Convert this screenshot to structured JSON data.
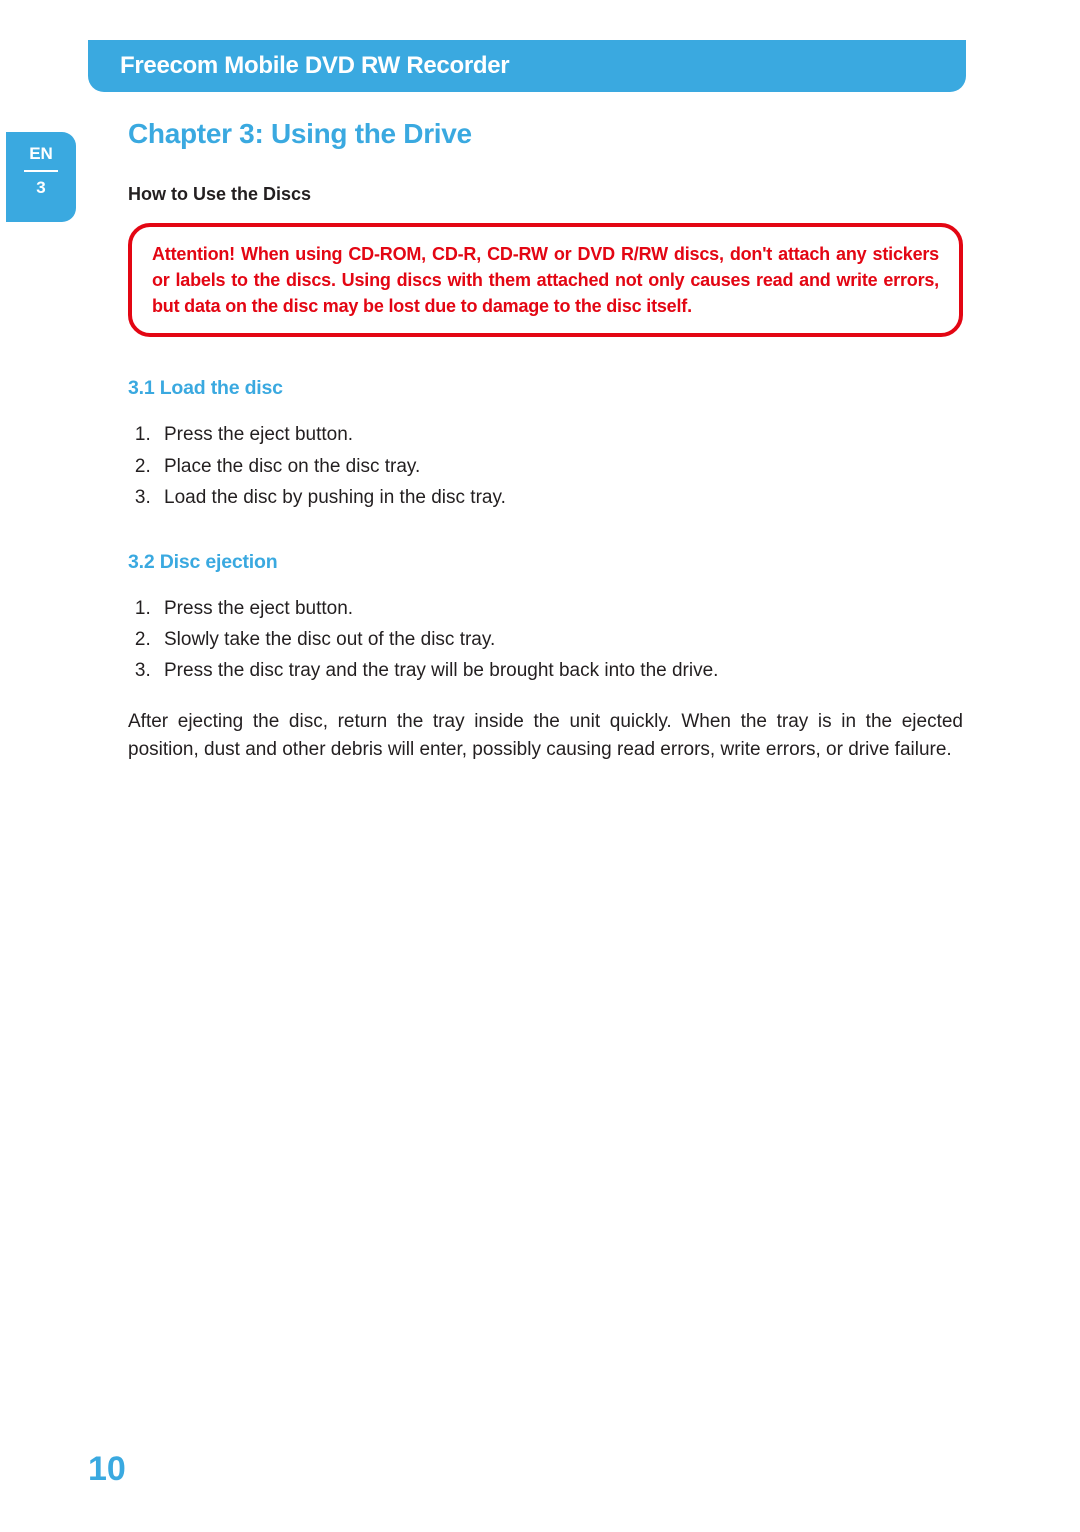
{
  "header": {
    "title": "Freecom Mobile DVD RW Recorder"
  },
  "sideTab": {
    "lang": "EN",
    "chapter": "3"
  },
  "chapter": {
    "title": "Chapter 3:  Using the Drive"
  },
  "section": {
    "title": "How to Use the Discs"
  },
  "warning": {
    "text": "Attention! When using CD-ROM, CD-R, CD-RW or DVD R/RW discs, don't attach any stickers or labels to the discs. Using discs with them attached not only causes read and write errors, but data on the disc may be lost due to damage to the disc itself."
  },
  "sub1": {
    "title": "3.1  Load the disc",
    "steps": [
      "Press the eject button.",
      "Place the disc on the disc tray.",
      "Load the disc by pushing in the disc tray."
    ]
  },
  "sub2": {
    "title": "3.2  Disc ejection",
    "steps": [
      "Press the eject button.",
      "Slowly take the disc out of the disc tray.",
      "Press the disc tray and the tray will be brought back into the drive."
    ],
    "note": "After ejecting the disc, return the tray inside the unit quickly. When the tray is in the ejected position, dust and other debris will enter, possibly causing read errors, write errors, or drive failure."
  },
  "pageNumber": "10"
}
